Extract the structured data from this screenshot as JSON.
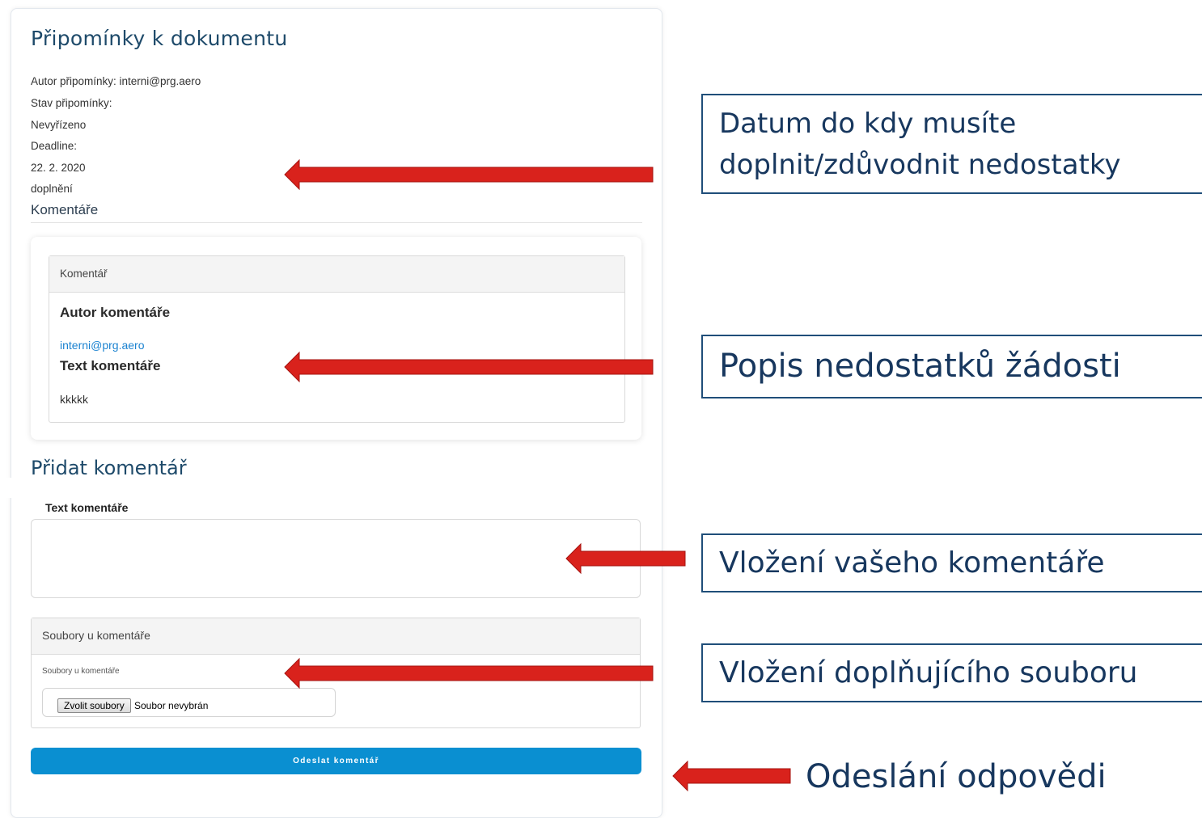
{
  "document": {
    "title": "Připomínky k dokumentu",
    "author_line": "Autor připomínky: interni@prg.aero",
    "status_label": "Stav připomínky:",
    "status_value": "Nevyřízeno",
    "deadline_label": "Deadline:",
    "deadline_value": "22. 2. 2020",
    "type_value": "doplnění"
  },
  "comments": {
    "heading": "Komentáře",
    "card_header": "Komentář",
    "author_label": "Autor komentáře",
    "author_value": "interni@prg.aero",
    "text_label": "Text komentáře",
    "text_value": "kkkkk"
  },
  "add_comment": {
    "heading": "Přidat komentář",
    "text_label": "Text komentáře",
    "text_value": "",
    "files_header": "Soubory u komentáře",
    "files_label": "Soubory u komentáře",
    "file_button": "Zvolit soubory",
    "file_status": "Soubor nevybrán",
    "submit_label": "Odeslat komentář"
  },
  "annotations": {
    "deadline_note_line1": "Datum do kdy musíte",
    "deadline_note_line2": "doplnit/zdůvodnit nedostatky",
    "description_note": "Popis nedostatků žádosti",
    "comment_note": "Vložení vašeho komentáře",
    "file_note": "Vložení doplňujícího souboru",
    "submit_note": "Odeslání odpovědi",
    "arrow_color": "#d9221c",
    "border_color": "#1f4e79"
  }
}
